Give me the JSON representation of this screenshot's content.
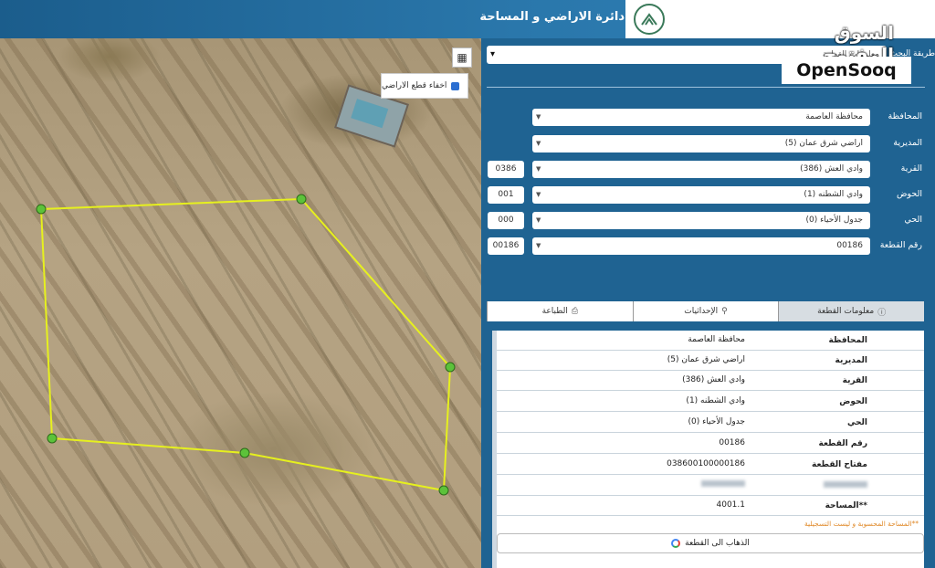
{
  "header": {
    "title": "دائرة الاراضي و المساحة"
  },
  "watermark": {
    "arabic": "السوق المفتوح",
    "english": "OpenSooq"
  },
  "map": {
    "hide_parcels_label": "اخفاء قطع الاراضي",
    "tool_icon": "grid-icon"
  },
  "search": {
    "method_label": "طريقة البحث",
    "method_value": "معلومات القطعة"
  },
  "form": {
    "governorate": {
      "label": "المحافظة",
      "value": "محافظة العاصمة"
    },
    "directorate": {
      "label": "المديرية",
      "value": "اراضي شرق عمان (5)"
    },
    "village": {
      "label": "القرية",
      "value": "وادي العش (386)",
      "code": "0386"
    },
    "basin": {
      "label": "الحوض",
      "value": "وادي الشطنه (1)",
      "code": "001"
    },
    "district": {
      "label": "الحي",
      "value": "جدول الأحياء (0)",
      "code": "000"
    },
    "parcel": {
      "label": "رقم القطعة",
      "value": "00186",
      "code": "00186"
    }
  },
  "tabs": [
    {
      "label": "معلومات القطعة",
      "icon": "info-icon"
    },
    {
      "label": "الإحداثيات",
      "icon": "pin-icon"
    },
    {
      "label": "الطباعة",
      "icon": "printer-icon"
    }
  ],
  "info": {
    "rows": [
      {
        "key": "المحافظة",
        "value": "محافظة العاصمة"
      },
      {
        "key": "المديرية",
        "value": "اراضي شرق عمان (5)"
      },
      {
        "key": "القرية",
        "value": "وادي العش (386)"
      },
      {
        "key": "الحوض",
        "value": "وادي الشطنه (1)"
      },
      {
        "key": "الحي",
        "value": "جدول الأحياء (0)"
      },
      {
        "key": "رقم القطعة",
        "value": "00186"
      },
      {
        "key": "مفتاح القطعة",
        "value": "038600100000186"
      },
      {
        "key": "المساحة",
        "value": "4001.1"
      }
    ],
    "area_key": "**المساحة",
    "note": "**المساحة المحسوبة و ليست التسجيلية",
    "goto_label": "الذهاب الى القطعة"
  },
  "colors": {
    "panel": "#1f6392",
    "parcel_line": "#e6f01e",
    "vertex": "#5cc23a"
  }
}
